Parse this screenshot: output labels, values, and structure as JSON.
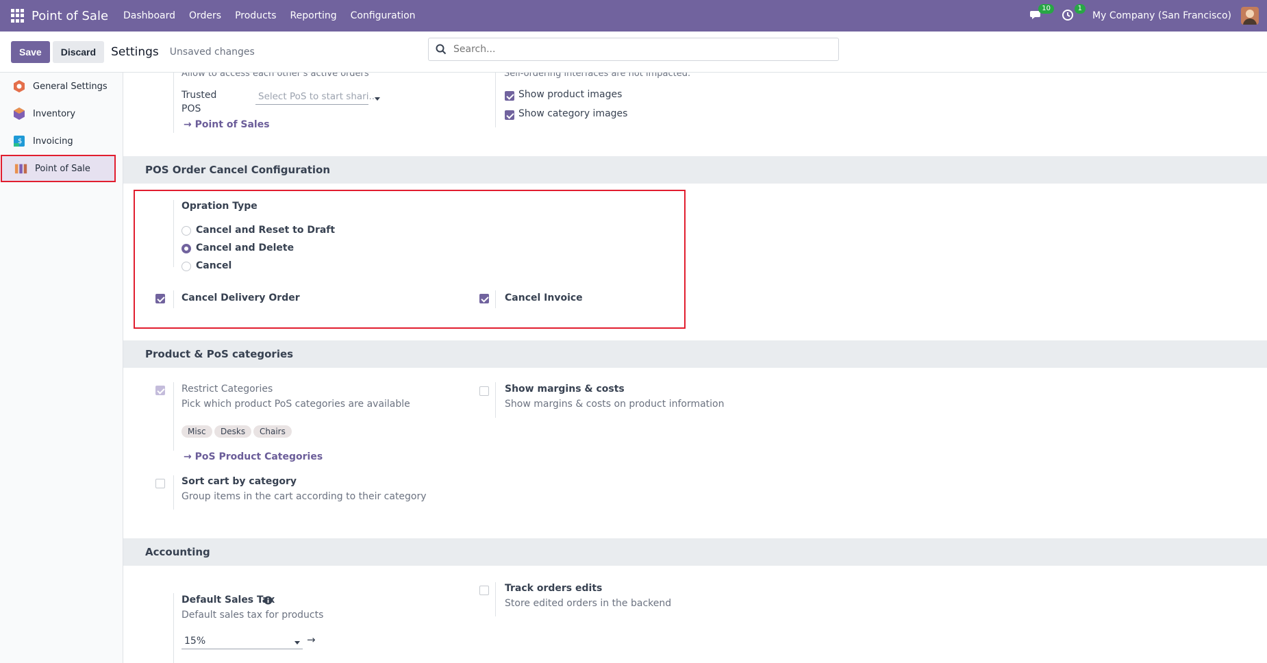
{
  "navbar": {
    "brand": "Point of Sale",
    "menu": [
      "Dashboard",
      "Orders",
      "Products",
      "Reporting",
      "Configuration"
    ],
    "messages_badge": "10",
    "activity_badge": "1",
    "company": "My Company (San Francisco)"
  },
  "control": {
    "save": "Save",
    "discard": "Discard",
    "title": "Settings",
    "status": "Unsaved changes",
    "search_placeholder": "Search..."
  },
  "sidebar": {
    "items": [
      {
        "label": "General Settings",
        "icon": "general-settings-icon",
        "color": "#e46f4b"
      },
      {
        "label": "Inventory",
        "icon": "inventory-icon",
        "color": "#7f5fb4"
      },
      {
        "label": "Invoicing",
        "icon": "invoicing-icon",
        "color": "#1f9ad6"
      },
      {
        "label": "Point of Sale",
        "icon": "point-of-sale-icon",
        "color": "#c06a4b"
      }
    ],
    "active": "Point of Sale"
  },
  "top_partial": {
    "cut_text_left": "Allow to access each other's active orders",
    "trusted_label": "Trusted POS",
    "trusted_placeholder": "Select PoS to start shari...",
    "point_of_sales_link": "Point of Sales",
    "cut_text_right": "Self-ordering interfaces are not impacted.",
    "show_product_images": "Show product images",
    "show_category_images": "Show category images"
  },
  "cancel_config": {
    "header": "POS Order Cancel Configuration",
    "operation_type_label": "Opration Type",
    "options": [
      "Cancel and Reset to Draft",
      "Cancel and Delete",
      "Cancel"
    ],
    "selected": "Cancel and Delete",
    "cancel_delivery_order": "Cancel Delivery Order",
    "cancel_invoice": "Cancel Invoice"
  },
  "categories": {
    "header": "Product & PoS categories",
    "restrict_title": "Restrict Categories",
    "restrict_desc": "Pick which product PoS categories are available",
    "tags": [
      "Misc",
      "Desks",
      "Chairs"
    ],
    "pos_categories_link": "PoS Product Categories",
    "margins_title": "Show margins & costs",
    "margins_desc": "Show margins & costs on product information",
    "sort_title": "Sort cart by category",
    "sort_desc": "Group items in the cart according to their category"
  },
  "accounting": {
    "header": "Accounting",
    "tax_title": "Default Sales Tax",
    "tax_desc": "Default sales tax for products",
    "tax_value": "15%",
    "track_title": "Track orders edits",
    "track_desc": "Store edited orders in the backend"
  }
}
